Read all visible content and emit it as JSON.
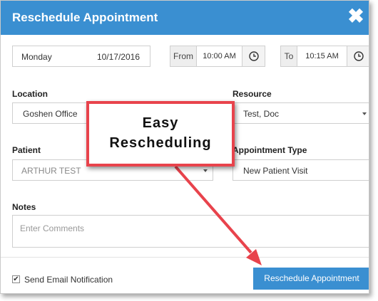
{
  "dialog": {
    "title": "Reschedule Appointment",
    "close_glyph": "✖"
  },
  "date": {
    "day": "Monday",
    "value": "10/17/2016"
  },
  "time_from": {
    "label": "From",
    "value": "10:00 AM",
    "icon": "clock-icon"
  },
  "time_to": {
    "label": "To",
    "value": "10:15 AM",
    "icon": "clock-icon"
  },
  "location": {
    "label": "Location",
    "value": "Goshen Office"
  },
  "resource": {
    "label": "Resource",
    "value": "Test, Doc"
  },
  "patient": {
    "label": "Patient",
    "value": "ARTHUR TEST"
  },
  "appointment_type": {
    "label": "Appointment Type",
    "value": "New Patient Visit"
  },
  "notes": {
    "label": "Notes",
    "placeholder": "Enter Comments"
  },
  "footer": {
    "email_notification_label": "Send Email Notification",
    "email_notification_checked": true,
    "check_glyph": "✔",
    "submit_label": "Reschedule Appointment"
  },
  "callout": {
    "line1": "Easy",
    "line2": "Rescheduling",
    "border_color": "#e8434c"
  },
  "colors": {
    "accent": "#3a8fd1"
  }
}
